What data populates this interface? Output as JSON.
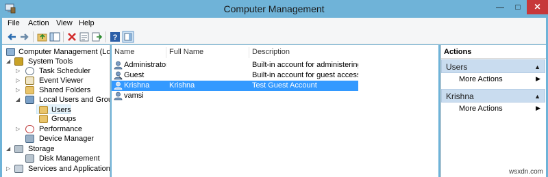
{
  "window": {
    "title": "Computer Management"
  },
  "menu": [
    "File",
    "Action",
    "View",
    "Help"
  ],
  "tree": {
    "root": "Computer Management (Local",
    "system_tools": "System Tools",
    "task_scheduler": "Task Scheduler",
    "event_viewer": "Event Viewer",
    "shared_folders": "Shared Folders",
    "local_users_groups": "Local Users and Groups",
    "users": "Users",
    "groups": "Groups",
    "performance": "Performance",
    "device_manager": "Device Manager",
    "storage": "Storage",
    "disk_management": "Disk Management",
    "services_apps": "Services and Applications"
  },
  "list": {
    "columns": [
      "Name",
      "Full Name",
      "Description"
    ],
    "rows": [
      {
        "name": "Administrator",
        "full_name": "",
        "description": "Built-in account for administering..."
      },
      {
        "name": "Guest",
        "full_name": "",
        "description": "Built-in account for guest access t..."
      },
      {
        "name": "Krishna",
        "full_name": "Krishna",
        "description": "Test Guest Account"
      },
      {
        "name": "vamsi",
        "full_name": "",
        "description": ""
      }
    ]
  },
  "actions": {
    "title": "Actions",
    "groups": [
      {
        "label": "Users",
        "item": "More Actions"
      },
      {
        "label": "Krishna",
        "item": "More Actions"
      }
    ]
  },
  "watermark": "wsxdn.com",
  "colors": {
    "titlebar": "#6fb3d8",
    "close": "#c7383a",
    "selection": "#3399ff",
    "action_group": "#c9dcef"
  }
}
